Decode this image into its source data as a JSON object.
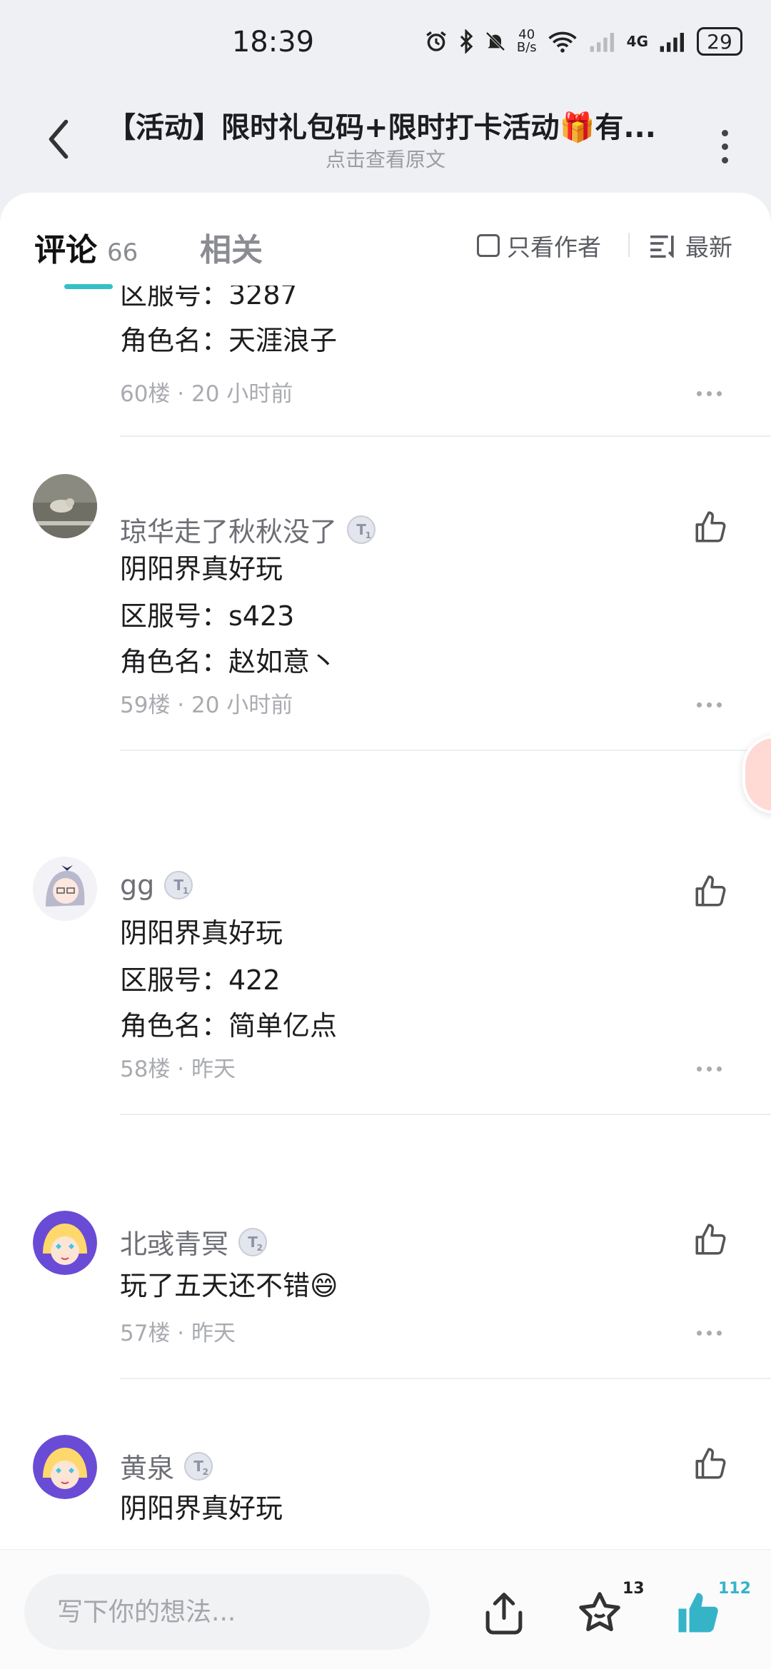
{
  "status": {
    "time": "18:39",
    "net_speed_top": "40",
    "net_speed_bottom": "B/s",
    "network": "4G",
    "battery": "29"
  },
  "header": {
    "title": "【活动】限时礼包码+限时打卡活动🎁有...",
    "subtitle": "点击查看原文"
  },
  "tabs": {
    "comments_label": "评论",
    "comments_count": "66",
    "related_label": "相关",
    "author_only_label": "只看作者",
    "sort_label": "最新"
  },
  "partial_comment": {
    "line_server": "区服号：3287",
    "line_role": "角色名：天涯浪子",
    "meta": "60楼 · 20 小时前"
  },
  "comments": [
    {
      "username": "琼华走了秋秋没了",
      "level": "T",
      "level_sub": "1",
      "lines": [
        "阴阳界真好玩",
        "区服号：s423",
        "角色名：赵如意丶"
      ],
      "meta": "59楼 · 20 小时前"
    },
    {
      "username": "gg",
      "level": "T",
      "level_sub": "1",
      "lines": [
        "阴阳界真好玩",
        "区服号：422",
        "角色名：简单亿点"
      ],
      "meta": "58楼 · 昨天"
    },
    {
      "username": "北彧青冥",
      "level": "T",
      "level_sub": "2",
      "lines": [
        "玩了五天还不错😄"
      ],
      "meta": "57楼 · 昨天"
    },
    {
      "username": "黄泉",
      "level": "T",
      "level_sub": "2",
      "lines": [
        "阴阳界真好玩"
      ],
      "meta": ""
    }
  ],
  "bottom_bar": {
    "input_placeholder": "写下你的想法...",
    "favorite_count": "13",
    "like_count": "112"
  },
  "colors": {
    "accent": "#35c0c8",
    "like_active": "#35b4c8"
  }
}
